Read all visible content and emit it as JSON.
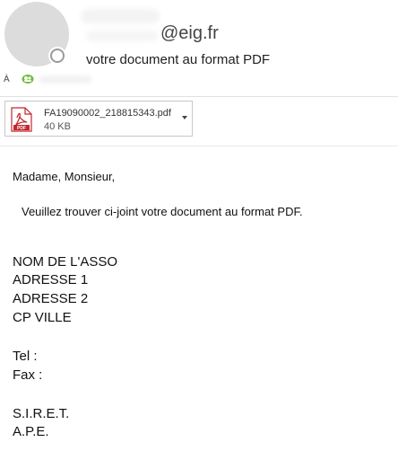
{
  "header": {
    "sender_domain": "@eig.fr",
    "subject": "votre document au format PDF",
    "to_label": "À"
  },
  "icons": {
    "avatar": "avatar",
    "presence": "presence-status-icon",
    "recipient": "contact-group-icon",
    "pdf": "pdf-file-icon",
    "chevron": "chevron-down-icon"
  },
  "colors": {
    "pdf_red": "#c1272d",
    "contact_green": "#6bbf3a",
    "border": "#c8c8c8"
  },
  "attachment": {
    "filename": "FA19090002_218815343.pdf",
    "size": "40 KB"
  },
  "body": {
    "greeting": "Madame, Monsieur,",
    "message": "Veuillez trouver ci-joint votre document au format PDF.",
    "signature": {
      "line1": "NOM DE L'ASSO",
      "line2": "ADRESSE 1",
      "line3": "ADRESSE 2",
      "line4": "CP VILLE",
      "tel": "Tel :",
      "fax": "Fax :",
      "siret": "S.I.R.E.T.",
      "ape": "A.P.E."
    }
  }
}
